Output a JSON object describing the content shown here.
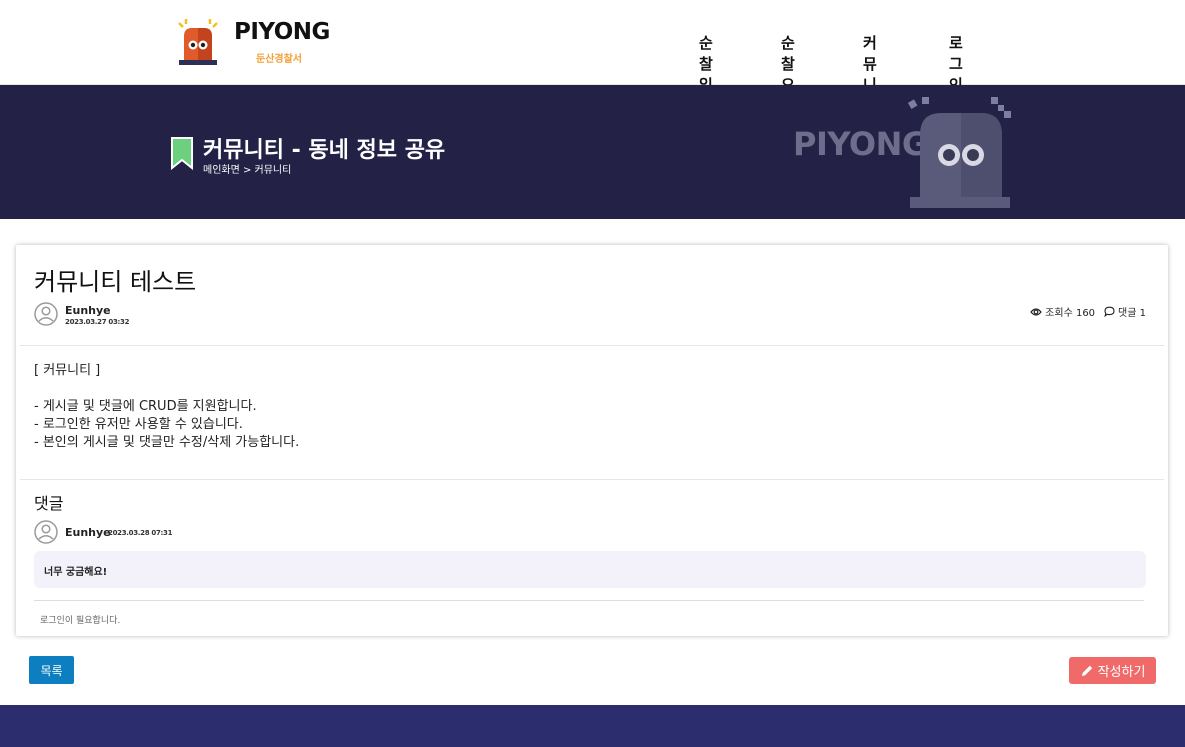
{
  "header": {
    "logo_text": "PIYONG",
    "logo_sub": "둔산경찰서",
    "nav": [
      "순찰일지",
      "순찰요청",
      "커뮤니티",
      "로그인"
    ]
  },
  "hero": {
    "title": "커뮤니티 - 동네 정보 공유",
    "breadcrumb": "메인화면 > 커뮤니티",
    "brand": "PIYONG"
  },
  "post": {
    "title": "커뮤니티 테스트",
    "author": "Eunhye",
    "date": "2023.03.27 03:32",
    "views_label": "조회수 160",
    "comments_label": "댓글 1",
    "content_lines": [
      "[ 커뮤니티 ]",
      "",
      "- 게시글 및 댓글에 CRUD를 지원합니다.",
      "- 로그인한 유저만 사용할 수 있습니다.",
      "- 본인의 게시글 및 댓글만 수정/삭제 가능합니다."
    ]
  },
  "comments": {
    "heading": "댓글",
    "items": [
      {
        "author": "Eunhye",
        "date": "2023.03.28 07:31",
        "text": "너무 궁금해요!"
      }
    ],
    "login_note": "로그인이 필요합니다."
  },
  "actions": {
    "list_label": "목록",
    "write_label": "작성하기"
  },
  "colors": {
    "hero_bg": "#232145",
    "footer_bg": "#2c2d6e",
    "primary_button": "#0d7fc1",
    "write_button": "#f16a6a",
    "bookmark": "#6cd07e",
    "logo_sub": "#f2a23a"
  }
}
